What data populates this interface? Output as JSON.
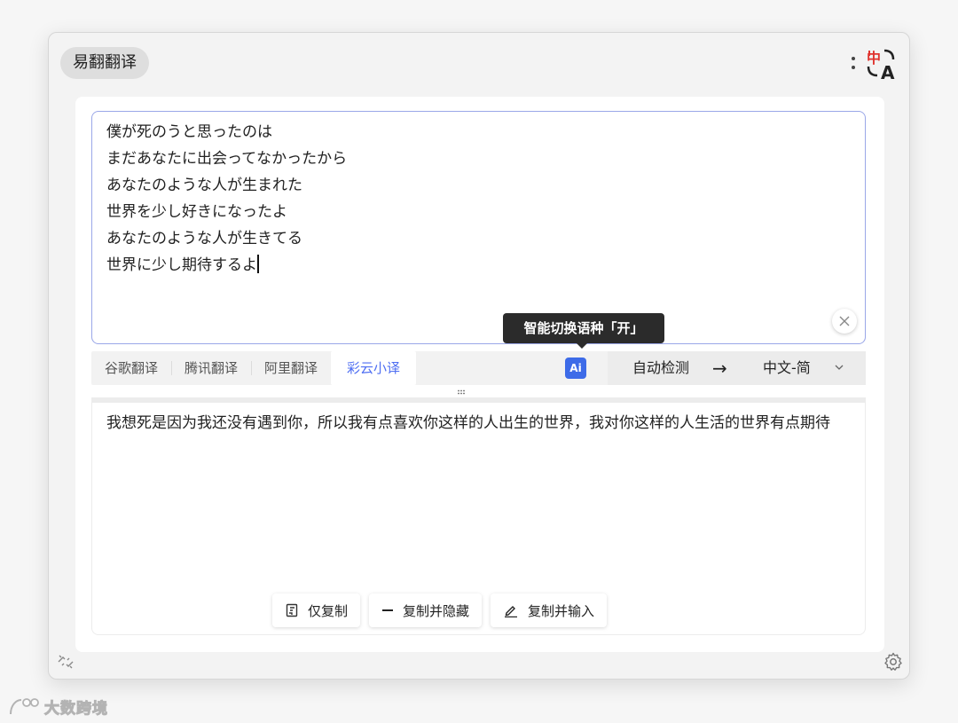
{
  "header": {
    "app_name": "易翻翻译",
    "logo_icon": "translate-zh-a-icon",
    "menu_icon": "vertical-dots-icon"
  },
  "source": {
    "lines": [
      "僕が死のうと思ったのは",
      "まだあなたに出会ってなかったから",
      "あなたのような人が生まれた",
      "世界を少し好きになったよ",
      "あなたのような人が生きてる",
      "世界に少し期待するよ"
    ],
    "clear_icon": "close-icon"
  },
  "tooltip": {
    "text": "智能切换语种「开」"
  },
  "engines": {
    "tabs": [
      "谷歌翻译",
      "腾讯翻译",
      "阿里翻译",
      "彩云小译"
    ],
    "active_index": 3
  },
  "ai_toggle": {
    "label": "Ai",
    "color": "#3d6be8"
  },
  "language": {
    "from": "自动检测",
    "arrow": "→",
    "to": "中文-简"
  },
  "result": {
    "text": "我想死是因为我还没有遇到你，所以我有点喜欢你这样的人出生的世界，我对你这样的人生活的世界有点期待"
  },
  "actions": {
    "copy_only": "仅复制",
    "copy_hide": "复制并隐藏",
    "copy_input": "复制并输入"
  },
  "footer": {
    "unlink_icon": "unlink-icon",
    "settings_icon": "gear-icon"
  },
  "watermark": {
    "text": "大数跨境"
  },
  "colors": {
    "accent": "#4e6ef2",
    "source_border": "#9aa7e8"
  }
}
